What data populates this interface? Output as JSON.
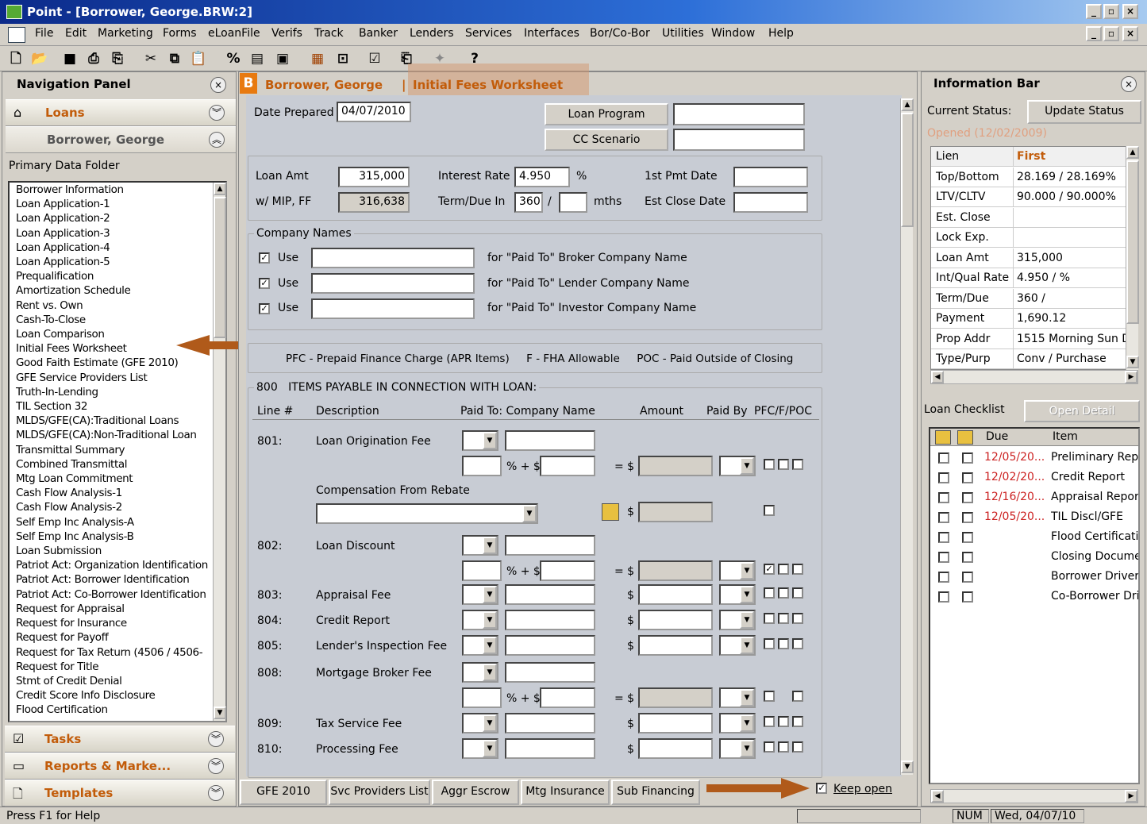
{
  "window": {
    "title": "Point - [Borrower, George.BRW:2]"
  },
  "menu": [
    "File",
    "Edit",
    "Marketing",
    "Forms",
    "eLoanFile",
    "Verifs",
    "Track",
    "Banker",
    "Lenders",
    "Services",
    "Interfaces",
    "Bor/Co-Bor",
    "Utilities",
    "Window",
    "Help"
  ],
  "toolbar_icons": [
    "new-file-icon",
    "open-folder-icon",
    "save-disk-icon",
    "print-icon",
    "print-preview-icon",
    "cut-scissors-icon",
    "copy-icon",
    "paste-icon",
    "percent-icon",
    "calculator-icon",
    "forms-icon",
    "ledger-icon",
    "inbox-icon",
    "checklist-icon",
    "notes-icon",
    "satellite-icon",
    "help-icon"
  ],
  "nav": {
    "title": "Navigation Panel",
    "loans": "Loans",
    "borrower": "Borrower, George",
    "folder_label": "Primary Data Folder",
    "items": [
      "Borrower Information",
      "Loan Application-1",
      "Loan Application-2",
      "Loan Application-3",
      "Loan Application-4",
      "Loan Application-5",
      "Prequalification",
      "Amortization Schedule",
      "Rent vs. Own",
      "Cash-To-Close",
      "Loan Comparison",
      "Initial Fees Worksheet",
      "Good Faith Estimate (GFE 2010)",
      "GFE Service Providers List",
      "Truth-In-Lending",
      "TIL Section 32",
      "MLDS/GFE(CA):Traditional Loans",
      "MLDS/GFE(CA):Non-Traditional Loan",
      "Transmittal Summary",
      "Combined Transmittal",
      "Mtg Loan Commitment",
      "Cash Flow Analysis-1",
      "Cash Flow Analysis-2",
      "Self Emp Inc Analysis-A",
      "Self Emp Inc Analysis-B",
      "Loan Submission",
      "Patriot Act: Organization Identification",
      "Patriot Act: Borrower Identification",
      "Patriot Act: Co-Borrower Identification",
      "Request for Appraisal",
      "Request for Insurance",
      "Request for Payoff",
      "Request for Tax Return (4506 / 4506-",
      "Request for Title",
      "Stmt of Credit Denial",
      "Credit Score Info Disclosure",
      "Flood Certification"
    ],
    "tasks": "Tasks",
    "reports": "Reports & Marke...",
    "templates": "Templates"
  },
  "form": {
    "badge": "B",
    "borrower": "Borrower, George",
    "title": "Initial Fees Worksheet",
    "date_label": "Date Prepared",
    "date_value": "04/07/2010",
    "loan_program_btn": "Loan Program",
    "cc_scenario_btn": "CC Scenario",
    "loan_amt_label": "Loan Amt",
    "loan_amt_value": "315,000",
    "mip_label": "w/ MIP, FF",
    "mip_value": "316,638",
    "interest_label": "Interest Rate",
    "interest_value": "4.950",
    "pct": "%",
    "term_label": "Term/Due In",
    "term_value": "360",
    "slash": "/",
    "mths": "mths",
    "first_pmt_label": "1st Pmt Date",
    "est_close_label": "Est Close Date",
    "company_names": "Company Names",
    "use": "Use",
    "broker_note": "for \"Paid To\" Broker Company Name",
    "lender_note": "for \"Paid To\" Lender Company Name",
    "investor_note": "for \"Paid To\" Investor Company Name",
    "legend": "PFC - Prepaid Finance Charge (APR Items)     F - FHA Allowable     POC - Paid Outside of Closing",
    "section800": "800   ITEMS PAYABLE IN CONNECTION WITH LOAN:",
    "col_line": "Line #",
    "col_desc": "Description",
    "col_paidto": "Paid To: Company Name",
    "col_amount": "Amount",
    "col_paidby": "Paid By",
    "col_pfc": "PFC/F/POC",
    "comp_rebate": "Compensation From Rebate",
    "pct_plus": "% + $",
    "eq": "= $",
    "dollar": "$",
    "lines": [
      {
        "num": "801:",
        "desc": "Loan Origination Fee"
      },
      {
        "num": "802:",
        "desc": "Loan Discount"
      },
      {
        "num": "803:",
        "desc": "Appraisal Fee"
      },
      {
        "num": "804:",
        "desc": "Credit Report"
      },
      {
        "num": "805:",
        "desc": "Lender's Inspection Fee"
      },
      {
        "num": "808:",
        "desc": "Mortgage Broker Fee"
      },
      {
        "num": "809:",
        "desc": "Tax Service Fee"
      },
      {
        "num": "810:",
        "desc": "Processing Fee"
      }
    ],
    "tabs": [
      "GFE 2010",
      "Svc Providers List",
      "Aggr Escrow",
      "Mtg Insurance",
      "Sub Financing"
    ],
    "keep_open": "Keep open"
  },
  "info": {
    "title": "Information Bar",
    "current_status": "Current Status:",
    "update_status": "Update Status",
    "opened": "Opened (12/02/2009)",
    "rows": [
      {
        "k": "Lien",
        "v": "First"
      },
      {
        "k": "Top/Bottom",
        "v": "28.169 / 28.169%"
      },
      {
        "k": "LTV/CLTV",
        "v": "90.000 / 90.000%"
      },
      {
        "k": "Est. Close",
        "v": ""
      },
      {
        "k": "Lock Exp.",
        "v": ""
      },
      {
        "k": "Loan Amt",
        "v": "315,000"
      },
      {
        "k": "Int/Qual Rate",
        "v": "4.950 / %"
      },
      {
        "k": "Term/Due",
        "v": "360 /"
      },
      {
        "k": "Payment",
        "v": "1,690.12"
      },
      {
        "k": "Prop Addr",
        "v": "1515 Morning Sun D"
      },
      {
        "k": "Type/Purp",
        "v": "Conv / Purchase"
      }
    ],
    "checklist_label": "Loan Checklist",
    "open_detail": "Open Detail",
    "col_due": "Due",
    "col_item": "Item",
    "checklist": [
      {
        "due": "12/05/20...",
        "item": "Preliminary Repo"
      },
      {
        "due": "12/02/20...",
        "item": "Credit Report"
      },
      {
        "due": "12/16/20...",
        "item": "Appraisal Report"
      },
      {
        "due": "12/05/20...",
        "item": "TIL Discl/GFE"
      },
      {
        "due": "",
        "item": "Flood Certificatio"
      },
      {
        "due": "",
        "item": "Closing Documer"
      },
      {
        "due": "",
        "item": "Borrower Drivers"
      },
      {
        "due": "",
        "item": "Co-Borrower Driv"
      }
    ]
  },
  "status": {
    "help": "Press F1 for Help",
    "num": "NUM",
    "date": "Wed, 04/07/10"
  },
  "colors": {
    "accent": "#c25c0a",
    "due_red": "#cc2222",
    "arrow": "#b05a1a",
    "title_blue": "#0b2a8a"
  }
}
